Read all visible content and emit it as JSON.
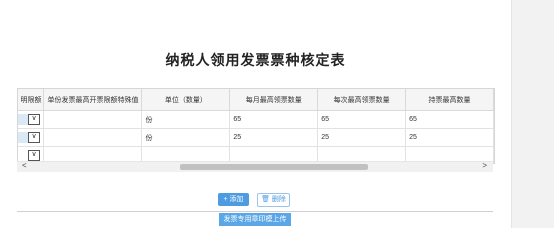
{
  "title": "纳税人领用发票票种核定表",
  "table": {
    "headers": [
      "明限额",
      "单份发票最高开票限额特殊值",
      "单位（数量）",
      "每月最高领票数量",
      "每次最高领票数量",
      "持票最高数量"
    ],
    "rows": [
      {
        "unit": "份",
        "monthly": "65",
        "each": "65",
        "hold": "65"
      },
      {
        "unit": "份",
        "monthly": "25",
        "each": "25",
        "hold": "25"
      },
      {
        "unit": "",
        "monthly": "",
        "each": "",
        "hold": ""
      }
    ],
    "select_arrow": "∨"
  },
  "buttons": {
    "add": "+ 添加",
    "delete": "🗑 删除",
    "upload": "发票专用章印模上传"
  },
  "scroll": {
    "left_arrow": "<",
    "right_arrow": ">"
  }
}
